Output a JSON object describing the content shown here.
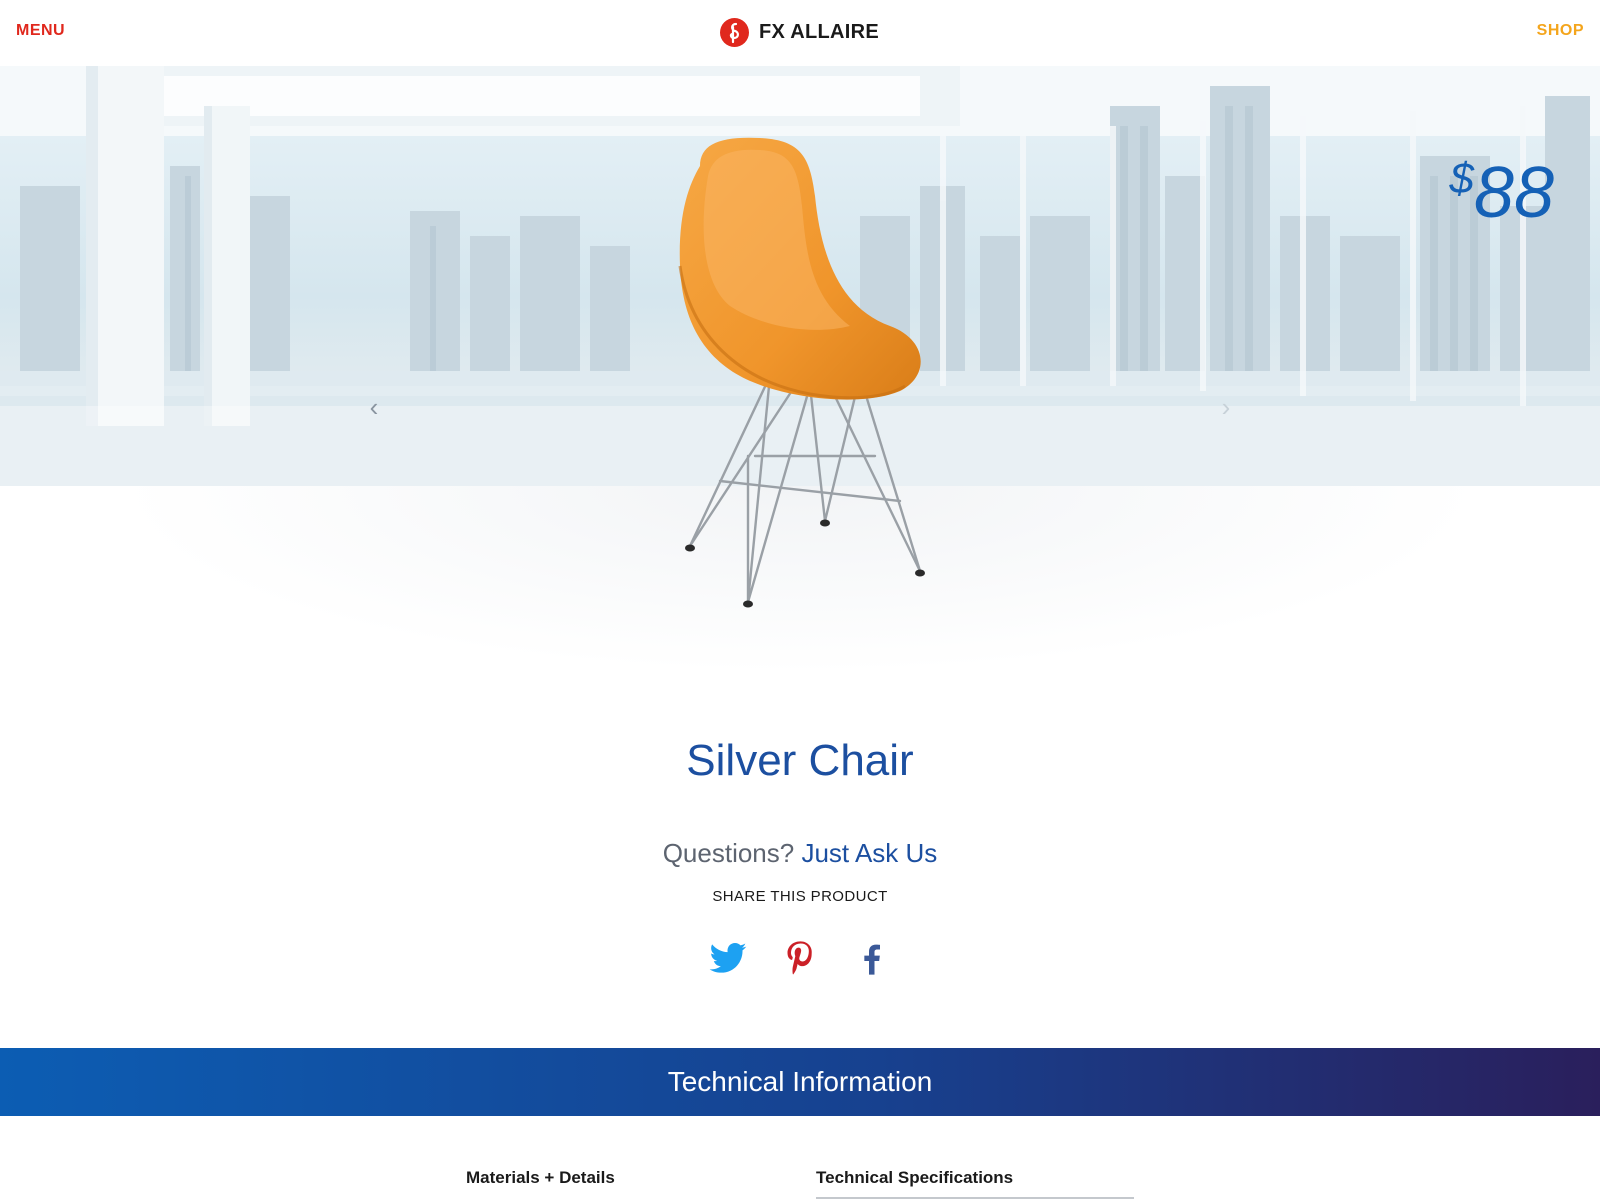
{
  "header": {
    "menu_label": "MENU",
    "brand_name": "FX ALLAIRE",
    "shop_label": "SHOP"
  },
  "hero": {
    "price_currency": "$",
    "price_amount": "88",
    "prev_arrow": "‹",
    "next_arrow": "›"
  },
  "product": {
    "title": "Silver Chair",
    "questions_text": "Questions?",
    "ask_link": "Just Ask Us",
    "share_label": "SHARE THIS PRODUCT",
    "social": [
      "twitter-icon",
      "pinterest-icon",
      "facebook-icon"
    ]
  },
  "technical": {
    "title": "Technical Information",
    "tabs": [
      "Materials + Details",
      "Technical Specifications"
    ]
  },
  "colors": {
    "menu": "#e0281d",
    "shop": "#f4a51c",
    "brand_blue": "#1c4fa0",
    "price_blue": "#1561b6",
    "chair_orange": "#f39a2e",
    "twitter": "#1da1f2",
    "pinterest": "#cb2027",
    "facebook": "#3b5998"
  }
}
